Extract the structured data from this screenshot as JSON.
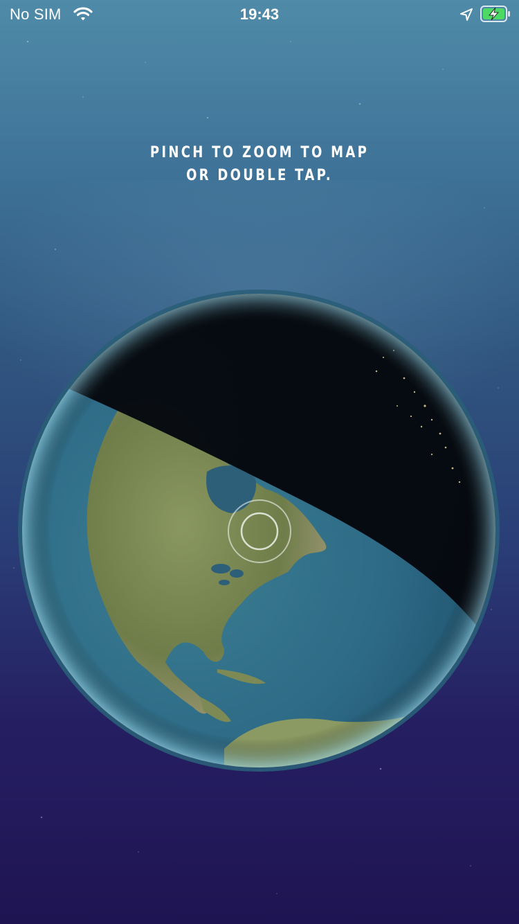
{
  "status_bar": {
    "carrier": "No SIM",
    "time": "19:43",
    "icons": [
      "wifi-icon",
      "location-arrow-icon",
      "battery-charging-icon"
    ]
  },
  "instructions": {
    "line1": "PINCH TO ZOOM TO MAP",
    "line2": "OR DOUBLE TAP."
  },
  "globe": {
    "view": "earth-globe-north-america",
    "reticle_icon": "target-reticle-icon"
  },
  "colors": {
    "battery_fill": "#4cd964",
    "text": "#ffffff",
    "ocean": "#2d6a86",
    "night": "#05080e"
  }
}
